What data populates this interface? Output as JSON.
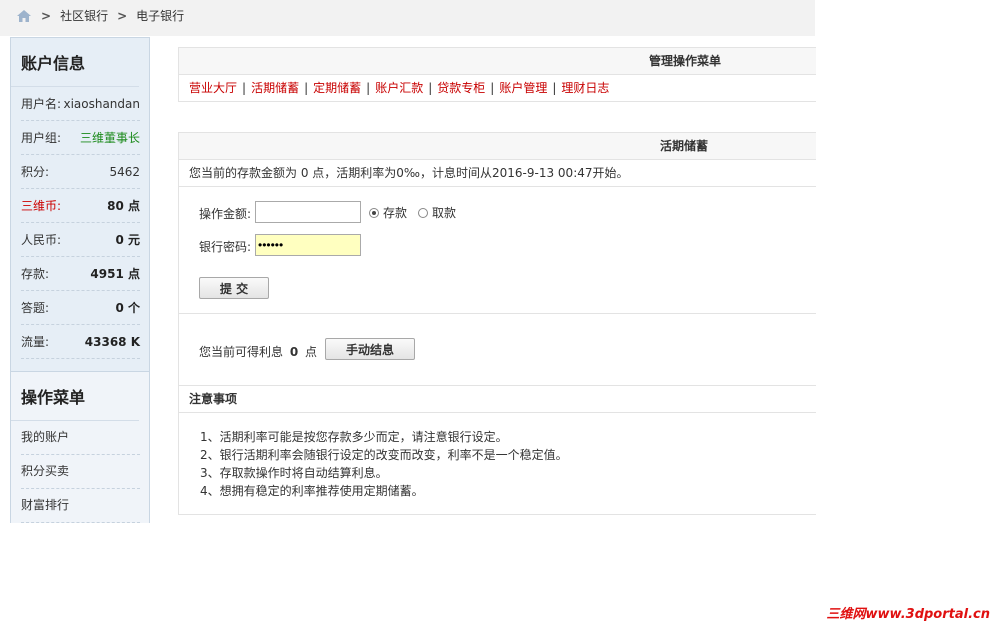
{
  "breadcrumb": {
    "items": [
      "社区银行",
      "电子银行"
    ],
    "separator": ">"
  },
  "account": {
    "title": "账户信息",
    "rows": [
      {
        "label": "用户名:",
        "value": "xiaoshandan"
      },
      {
        "label": "用户组:",
        "value": "三维董事长"
      },
      {
        "label": "积分:",
        "value": "5462"
      },
      {
        "label": "三维币:",
        "value": "80 点"
      },
      {
        "label": "人民币:",
        "value": "0 元"
      },
      {
        "label": "存款:",
        "value": "4951 点"
      },
      {
        "label": "答题:",
        "value": "0 个"
      },
      {
        "label": "流量:",
        "value": "43368 K"
      }
    ]
  },
  "ops_menu": {
    "title": "操作菜单",
    "items": [
      "我的账户",
      "积分买卖",
      "财富排行"
    ]
  },
  "manage": {
    "title": "管理操作菜单",
    "links": [
      "营业大厅",
      "活期储蓄",
      "定期储蓄",
      "账户汇款",
      "贷款专柜",
      "账户管理",
      "理财日志"
    ],
    "separator": "|"
  },
  "savings": {
    "title": "活期储蓄",
    "status_text": "您当前的存款金额为 0 点，活期利率为0‰，计息时间从2016-9-13 00:47开始。",
    "amount_label": "操作金额:",
    "amount_value": "",
    "radio_deposit": "存款",
    "radio_withdraw": "取款",
    "password_label": "银行密码:",
    "password_value": "••••••",
    "submit_label": "提 交",
    "interest_prefix": "您当前可得利息",
    "interest_value": "0",
    "interest_unit": "点",
    "settle_label": "手动结息"
  },
  "notice": {
    "title": "注意事项",
    "items": [
      "1、活期利率可能是按您存款多少而定，请注意银行设定。",
      "2、银行活期利率会随银行设定的改变而改变，利率不是一个稳定值。",
      "3、存取款操作时将自动结算利息。",
      "4、想拥有稳定的利率推荐使用定期储蓄。"
    ]
  },
  "watermark": "三维网www.3dportal.cn",
  "colors": {
    "link_red": "#c80000",
    "sidebar_bg": "#e6eef6",
    "group_green": "#1b8a1b"
  }
}
